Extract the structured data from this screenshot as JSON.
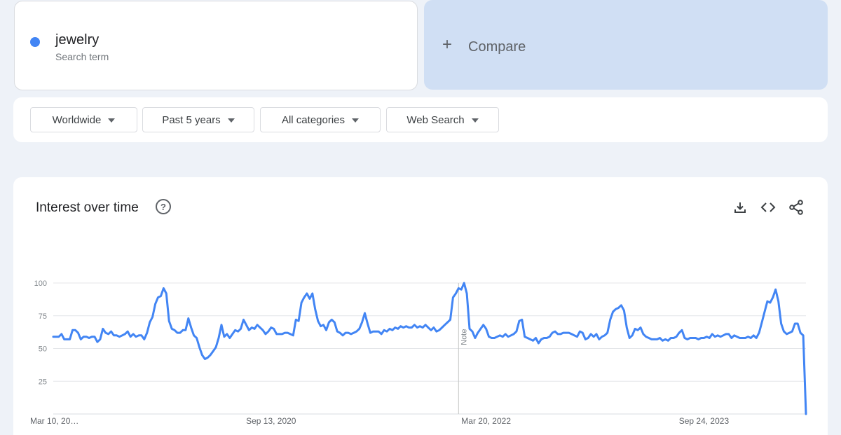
{
  "term": {
    "name": "jewelry",
    "subtitle": "Search term",
    "color": "#4285f4"
  },
  "compare": {
    "icon": "plus-icon",
    "label": "Compare"
  },
  "filters": [
    {
      "label": "Worldwide"
    },
    {
      "label": "Past 5 years"
    },
    {
      "label": "All categories"
    },
    {
      "label": "Web Search"
    }
  ],
  "panel": {
    "title": "Interest over time",
    "help_icon": "help-icon",
    "tools": [
      "download-icon",
      "embed-code-icon",
      "share-icon"
    ],
    "help_glyph": "?"
  },
  "chart_data": {
    "type": "line",
    "ylim": [
      0,
      100
    ],
    "y_ticks": [
      25,
      50,
      75,
      100
    ],
    "x_tick_labels": [
      "Mar 10, 20…",
      "Sep 13, 2020",
      "Mar 20, 2022",
      "Sep 24, 2023"
    ],
    "x_tick_index": [
      0,
      79,
      157,
      236
    ],
    "grid": true,
    "note_marker": {
      "label": "Note",
      "index": 147
    },
    "series": [
      {
        "name": "jewelry",
        "color": "#4285f4",
        "values": [
          59,
          59,
          59,
          61,
          57,
          57,
          57,
          64,
          64,
          62,
          57,
          59,
          59,
          58,
          59,
          59,
          55,
          57,
          65,
          62,
          61,
          63,
          60,
          60,
          59,
          60,
          61,
          63,
          59,
          61,
          59,
          60,
          60,
          57,
          62,
          70,
          74,
          84,
          89,
          90,
          96,
          92,
          71,
          65,
          64,
          62,
          62,
          64,
          64,
          73,
          66,
          60,
          58,
          51,
          45,
          42,
          43,
          45,
          48,
          51,
          58,
          68,
          59,
          61,
          58,
          61,
          64,
          63,
          65,
          72,
          68,
          64,
          66,
          65,
          68,
          66,
          64,
          61,
          63,
          66,
          65,
          61,
          61,
          61,
          62,
          62,
          61,
          60,
          72,
          71,
          85,
          89,
          92,
          88,
          92,
          80,
          71,
          67,
          68,
          64,
          70,
          72,
          70,
          63,
          62,
          60,
          62,
          62,
          61,
          62,
          63,
          65,
          70,
          77,
          69,
          62,
          63,
          63,
          63,
          61,
          64,
          63,
          65,
          64,
          66,
          65,
          67,
          66,
          67,
          66,
          66,
          68,
          66,
          67,
          66,
          68,
          66,
          64,
          66,
          63,
          64,
          66,
          68,
          70,
          72,
          89,
          92,
          96,
          95,
          100,
          92,
          65,
          63,
          58,
          62,
          65,
          68,
          65,
          59,
          58,
          58,
          59,
          60,
          59,
          61,
          59,
          60,
          61,
          63,
          71,
          72,
          59,
          58,
          57,
          56,
          58,
          54,
          57,
          58,
          58,
          59,
          62,
          63,
          61,
          61,
          62,
          62,
          62,
          61,
          60,
          59,
          63,
          62,
          57,
          58,
          61,
          59,
          61,
          57,
          59,
          60,
          62,
          72,
          78,
          80,
          81,
          83,
          79,
          66,
          58,
          60,
          65,
          64,
          66,
          61,
          59,
          58,
          57,
          57,
          57,
          58,
          56,
          57,
          56,
          58,
          58,
          59,
          62,
          64,
          58,
          57,
          58,
          58,
          58,
          57,
          58,
          58,
          59,
          58,
          61,
          59,
          60,
          59,
          60,
          61,
          61,
          58,
          60,
          59,
          58,
          58,
          58,
          59,
          58,
          60,
          58,
          62,
          70,
          78,
          86,
          85,
          89,
          95,
          86,
          69,
          63,
          61,
          62,
          63,
          69,
          69,
          62,
          60,
          0
        ]
      }
    ]
  }
}
